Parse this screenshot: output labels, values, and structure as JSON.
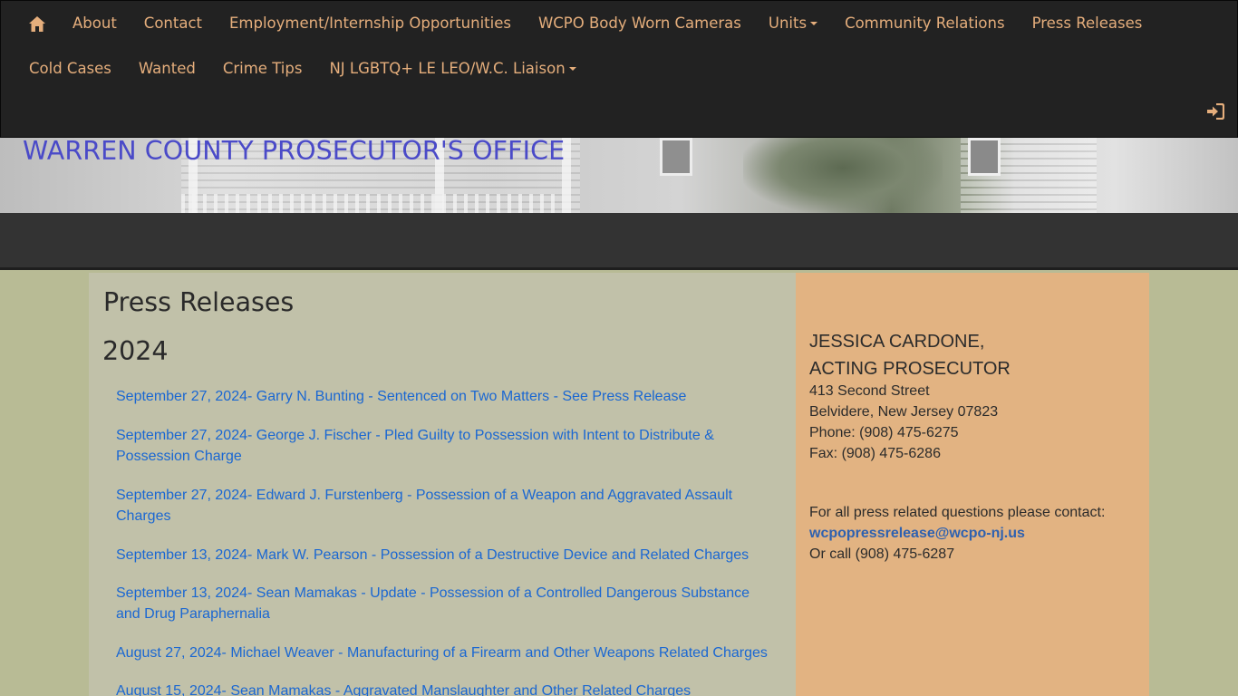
{
  "nav": {
    "home_icon": "home-icon",
    "row1": [
      "About",
      "Contact",
      "Employment/Internship Opportunities",
      "WCPO Body Worn Cameras",
      "Units",
      "Community Relations",
      "Press Releases"
    ],
    "row2": [
      "Cold Cases",
      "Wanted",
      "Crime Tips",
      "NJ LGBTQ+ LE LEO/W.C. Liaison"
    ],
    "login_icon": "login-icon",
    "accent_color": "#e5ae7c"
  },
  "banner": {
    "title": "WARREN COUNTY PROSECUTOR'S OFFICE",
    "title_color": "#4a4ac8"
  },
  "main": {
    "page_title": "Press Releases",
    "year": "2024",
    "press_releases": [
      "September 27, 2024- Garry N. Bunting - Sentenced on Two Matters - See Press Release",
      "September 27, 2024- George J. Fischer - Pled Guilty to Possession with Intent to Distribute & Possession Charge",
      "September 27, 2024- Edward J. Furstenberg - Possession of a Weapon and Aggravated Assault Charges",
      "September 13, 2024- Mark W. Pearson - Possession of a Destructive Device and Related Charges",
      "September 13, 2024- Sean Mamakas - Update - Possession of a Controlled Dangerous Substance and Drug Paraphernalia",
      "August 27, 2024- Michael Weaver - Manufacturing of a Firearm and Other Weapons Related Charges",
      "August 15, 2024- Sean Mamakas - Aggravated Manslaughter and Other Related Charges"
    ],
    "link_color": "#1a67d2"
  },
  "sidebar": {
    "name": "JESSICA CARDONE,",
    "title": "ACTING PROSECUTOR",
    "address1": "413 Second Street",
    "address2": "Belvidere, New Jersey 07823",
    "phone": "Phone: (908) 475-6275",
    "fax": "Fax: (908) 475-6286",
    "press_contact_text": "For all press related questions please contact:",
    "press_email": "wcpopressrelease@wcpo-nj.us",
    "press_phone": "Or call (908) 475-6287",
    "background": "#e2b382"
  }
}
